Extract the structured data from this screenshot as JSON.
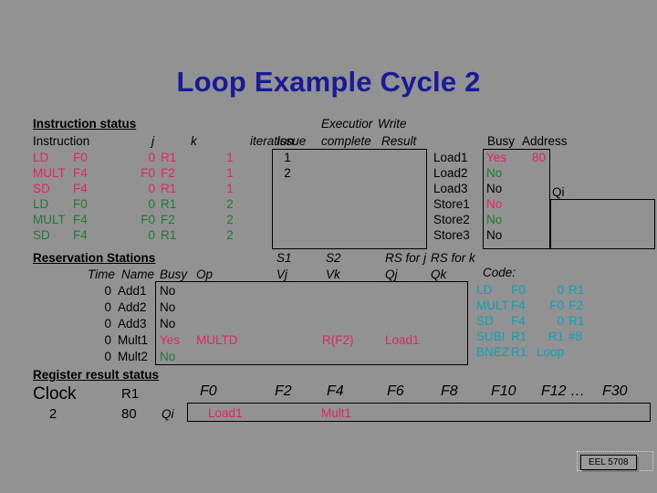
{
  "title": "Loop Example Cycle 2",
  "sections": {
    "instruction_status": "Instruction status",
    "reservation_stations": "Reservation Stations",
    "register_result_status": "Register result status"
  },
  "instruction_table": {
    "headers": {
      "instruction": "Instruction",
      "j": "j",
      "k": "k",
      "iteration": "iteration",
      "issue": "Issue",
      "execution": "Executior",
      "execution_line2": "complete",
      "write": "Write",
      "write_line2": "Result"
    },
    "rows": [
      {
        "op": "LD",
        "dest": "F0",
        "j": "0",
        "k": "R1",
        "iteration": "1",
        "issue": "1",
        "exec": "",
        "write": "",
        "color": "pink"
      },
      {
        "op": "MULT",
        "dest": "F4",
        "j": "F0",
        "k": "F2",
        "iteration": "1",
        "issue": "2",
        "exec": "",
        "write": "",
        "color": "pink"
      },
      {
        "op": "SD",
        "dest": "F4",
        "j": "0",
        "k": "R1",
        "iteration": "1",
        "issue": "",
        "exec": "",
        "write": "",
        "color": "pink"
      },
      {
        "op": "LD",
        "dest": "F0",
        "j": "0",
        "k": "R1",
        "iteration": "2",
        "issue": "",
        "exec": "",
        "write": "",
        "color": "green"
      },
      {
        "op": "MULT",
        "dest": "F4",
        "j": "F0",
        "k": "F2",
        "iteration": "2",
        "issue": "",
        "exec": "",
        "write": "",
        "color": "green"
      },
      {
        "op": "SD",
        "dest": "F4",
        "j": "0",
        "k": "R1",
        "iteration": "2",
        "issue": "",
        "exec": "",
        "write": "",
        "color": "green"
      }
    ]
  },
  "load_store_table": {
    "headers": {
      "busy": "Busy",
      "address": "Address",
      "qi": "Qi"
    },
    "rows": [
      {
        "name": "Load1",
        "busy": "Yes",
        "address": "80",
        "qi": "",
        "color": "pink"
      },
      {
        "name": "Load2",
        "busy": "No",
        "address": "",
        "qi": "",
        "color": "green"
      },
      {
        "name": "Load3",
        "busy": "No",
        "address": "",
        "qi": "",
        "color": "black"
      },
      {
        "name": "Store1",
        "busy": "No",
        "address": "",
        "qi": "",
        "color": "pink"
      },
      {
        "name": "Store2",
        "busy": "No",
        "address": "",
        "qi": "",
        "color": "green"
      },
      {
        "name": "Store3",
        "busy": "No",
        "address": "",
        "qi": "",
        "color": "black"
      }
    ]
  },
  "rs_table": {
    "headers": {
      "time": "Time",
      "name": "Name",
      "busy": "Busy",
      "op": "Op",
      "s1": "S1",
      "vj": "Vj",
      "s2": "S2",
      "vk": "Vk",
      "rs_for_j": "RS for j",
      "qj": "Qj",
      "rs_for_k": "RS for k",
      "qk": "Qk"
    },
    "rows": [
      {
        "time": "0",
        "name": "Add1",
        "busy": "No",
        "op": "",
        "vj": "",
        "vk": "",
        "qj": "",
        "qk": "",
        "color": "black"
      },
      {
        "time": "0",
        "name": "Add2",
        "busy": "No",
        "op": "",
        "vj": "",
        "vk": "",
        "qj": "",
        "qk": "",
        "color": "black"
      },
      {
        "time": "0",
        "name": "Add3",
        "busy": "No",
        "op": "",
        "vj": "",
        "vk": "",
        "qj": "",
        "qk": "",
        "color": "black"
      },
      {
        "time": "0",
        "name": "Mult1",
        "busy": "Yes",
        "op": "MULTD",
        "vj": "",
        "vk": "R(F2)",
        "qj": "Load1",
        "qk": "",
        "color": "pink"
      },
      {
        "time": "0",
        "name": "Mult2",
        "busy": "No",
        "op": "",
        "vj": "",
        "vk": "",
        "qj": "",
        "qk": "",
        "color": "green"
      }
    ]
  },
  "code": {
    "label": "Code:",
    "lines": [
      {
        "op": "LD",
        "a": "F0",
        "b": "0",
        "c": "R1"
      },
      {
        "op": "MULT",
        "a": "F4",
        "b": "F0",
        "c": "F2"
      },
      {
        "op": "SD",
        "a": "F4",
        "b": "0",
        "c": "R1"
      },
      {
        "op": "SUBI",
        "a": "R1",
        "b": "R1",
        "c": "#8"
      },
      {
        "op": "BNEZ",
        "a": "R1",
        "b": "Loop",
        "c": ""
      }
    ]
  },
  "register_status": {
    "clock_label": "Clock",
    "clock_value": "2",
    "r1_label": "R1",
    "r1_value": "80",
    "qi_label": "Qi",
    "registers": [
      "F0",
      "F2",
      "F4",
      "F6",
      "F8",
      "F10",
      "F12 …",
      "F30"
    ],
    "values": [
      {
        "reg": "F0",
        "value": "Load1"
      },
      {
        "reg": "F4",
        "value": "Mult1"
      }
    ]
  },
  "footer": {
    "label": "EEL 5708"
  },
  "colors": {
    "background": "#929292",
    "title": "#1a1a99",
    "pink": "#e0246e",
    "green": "#1f7a35",
    "cyan": "#0fa3bf",
    "black": "#000000"
  }
}
